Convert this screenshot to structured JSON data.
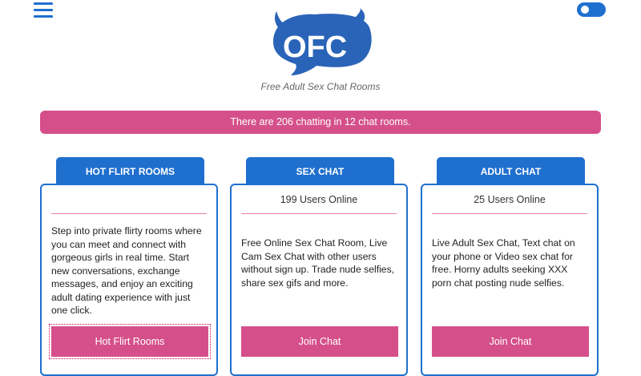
{
  "header": {
    "menu_icon": "hamburger-menu-icon",
    "toggle_icon": "toggle-switch-icon",
    "logo_text": "OFC",
    "tagline": "Free Adult Sex Chat Rooms"
  },
  "banner": {
    "text": "There are 206 chatting in 12 chat rooms."
  },
  "colors": {
    "brand_blue": "#1f6fcf",
    "accent_pink": "#d5508a",
    "divider_pink": "#e87fa5"
  },
  "rooms": [
    {
      "tab": "HOT FLIRT ROOMS",
      "users": "",
      "description": "Step into private flirty rooms where you can meet and connect with gorgeous girls in real time. Start new conversations, exchange messages, and enjoy an exciting adult dating experience with just one click.",
      "button": "Hot Flirt Rooms"
    },
    {
      "tab": "SEX CHAT",
      "users": "199 Users Online",
      "description": "Free Online Sex Chat Room, Live Cam Sex Chat with other users without sign up. Trade nude selfies, share sex gifs and more.",
      "button": "Join Chat"
    },
    {
      "tab": "ADULT CHAT",
      "users": "25 Users Online",
      "description": "Live Adult Sex Chat, Text chat on your phone or Video sex chat for free. Horny adults seeking XXX porn chat posting nude selfies.",
      "button": "Join Chat"
    }
  ]
}
